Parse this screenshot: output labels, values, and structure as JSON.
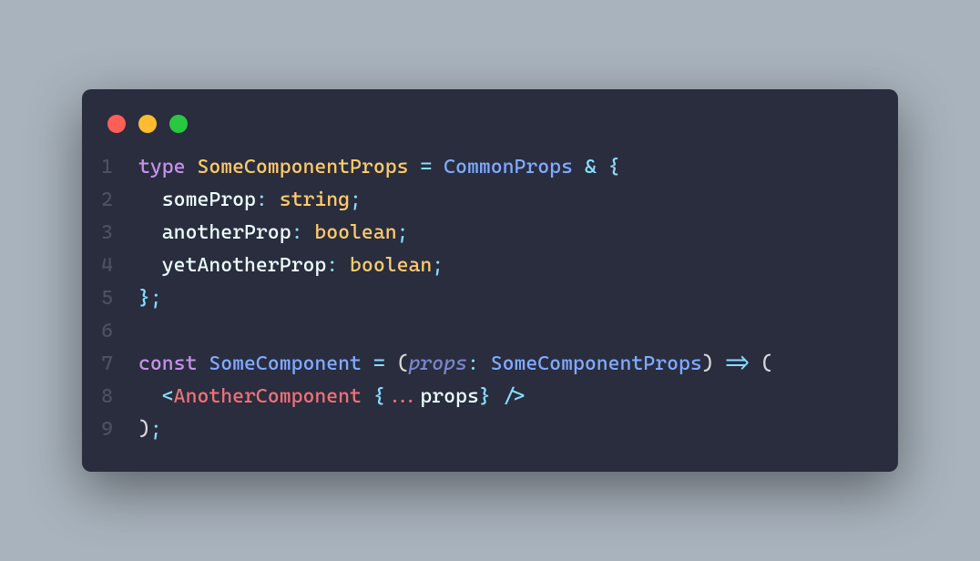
{
  "window": {
    "traffic_lights": {
      "close": {
        "color": "#ff5f57"
      },
      "minimize": {
        "color": "#febc2e"
      },
      "zoom": {
        "color": "#28c840"
      }
    },
    "background": "#292d3e"
  },
  "code": {
    "language": "tsx",
    "lines": [
      {
        "n": "1",
        "tokens": [
          {
            "t": "type",
            "c": "tok-keyword"
          },
          {
            "t": " ",
            "c": "tok-plain"
          },
          {
            "t": "SomeComponentProps",
            "c": "tok-type"
          },
          {
            "t": " ",
            "c": "tok-plain"
          },
          {
            "t": "=",
            "c": "tok-operator"
          },
          {
            "t": " ",
            "c": "tok-plain"
          },
          {
            "t": "CommonProps",
            "c": "tok-typeref"
          },
          {
            "t": " ",
            "c": "tok-plain"
          },
          {
            "t": "&",
            "c": "tok-operator"
          },
          {
            "t": " ",
            "c": "tok-plain"
          },
          {
            "t": "{",
            "c": "tok-punct"
          }
        ]
      },
      {
        "n": "2",
        "tokens": [
          {
            "t": "  ",
            "c": "tok-plain"
          },
          {
            "t": "someProp",
            "c": "tok-prop"
          },
          {
            "t": ":",
            "c": "tok-operator"
          },
          {
            "t": " ",
            "c": "tok-plain"
          },
          {
            "t": "string",
            "c": "tok-type"
          },
          {
            "t": ";",
            "c": "tok-punct"
          }
        ]
      },
      {
        "n": "3",
        "tokens": [
          {
            "t": "  ",
            "c": "tok-plain"
          },
          {
            "t": "anotherProp",
            "c": "tok-prop"
          },
          {
            "t": ":",
            "c": "tok-operator"
          },
          {
            "t": " ",
            "c": "tok-plain"
          },
          {
            "t": "boolean",
            "c": "tok-type"
          },
          {
            "t": ";",
            "c": "tok-punct"
          }
        ]
      },
      {
        "n": "4",
        "tokens": [
          {
            "t": "  ",
            "c": "tok-plain"
          },
          {
            "t": "yetAnotherProp",
            "c": "tok-prop"
          },
          {
            "t": ":",
            "c": "tok-operator"
          },
          {
            "t": " ",
            "c": "tok-plain"
          },
          {
            "t": "boolean",
            "c": "tok-type"
          },
          {
            "t": ";",
            "c": "tok-punct"
          }
        ]
      },
      {
        "n": "5",
        "tokens": [
          {
            "t": "}",
            "c": "tok-punct"
          },
          {
            "t": ";",
            "c": "tok-punct"
          }
        ]
      },
      {
        "n": "6",
        "tokens": [
          {
            "t": "",
            "c": "tok-plain"
          }
        ]
      },
      {
        "n": "7",
        "tokens": [
          {
            "t": "const",
            "c": "tok-keyword"
          },
          {
            "t": " ",
            "c": "tok-plain"
          },
          {
            "t": "SomeComponent",
            "c": "tok-func"
          },
          {
            "t": " ",
            "c": "tok-plain"
          },
          {
            "t": "=",
            "c": "tok-operator"
          },
          {
            "t": " ",
            "c": "tok-plain"
          },
          {
            "t": "(",
            "c": "tok-brace"
          },
          {
            "t": "props",
            "c": "tok-param"
          },
          {
            "t": ":",
            "c": "tok-operator"
          },
          {
            "t": " ",
            "c": "tok-plain"
          },
          {
            "t": "SomeComponentProps",
            "c": "tok-typeref"
          },
          {
            "t": ")",
            "c": "tok-brace"
          },
          {
            "t": " ",
            "c": "tok-plain"
          },
          {
            "t": "=>",
            "c": "tok-operator"
          },
          {
            "t": " ",
            "c": "tok-plain"
          },
          {
            "t": "(",
            "c": "tok-brace"
          }
        ]
      },
      {
        "n": "8",
        "tokens": [
          {
            "t": "  ",
            "c": "tok-plain"
          },
          {
            "t": "<",
            "c": "tok-tagpunct"
          },
          {
            "t": "AnotherComponent",
            "c": "tok-tag"
          },
          {
            "t": " ",
            "c": "tok-plain"
          },
          {
            "t": "{",
            "c": "tok-attrpunct"
          },
          {
            "t": "...",
            "c": "tok-spread"
          },
          {
            "t": "props",
            "c": "tok-spreadvar"
          },
          {
            "t": "}",
            "c": "tok-attrpunct"
          },
          {
            "t": " ",
            "c": "tok-plain"
          },
          {
            "t": "/>",
            "c": "tok-tagpunct"
          }
        ]
      },
      {
        "n": "9",
        "tokens": [
          {
            "t": ")",
            "c": "tok-brace"
          },
          {
            "t": ";",
            "c": "tok-punct"
          }
        ]
      }
    ]
  }
}
